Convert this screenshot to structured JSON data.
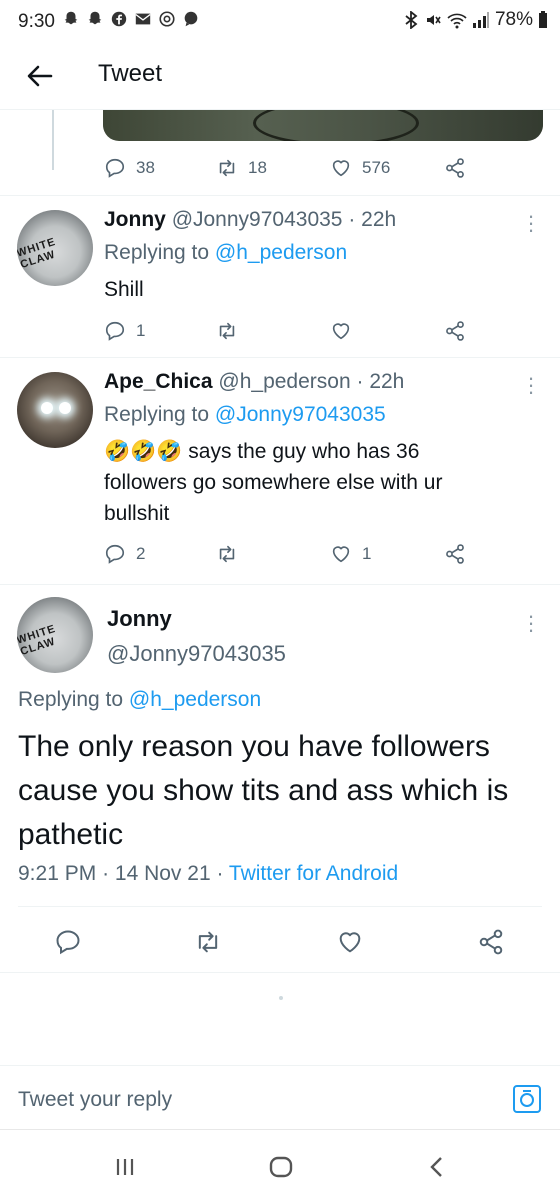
{
  "status_bar": {
    "time": "9:30",
    "battery": "78%",
    "left_icons": [
      "snapchat-icon",
      "snapchat-icon",
      "facebook-icon",
      "mail-icon",
      "at-icon",
      "message-icon"
    ],
    "right_icons": [
      "bluetooth-icon",
      "mute-icon",
      "wifi-icon",
      "signal-icon",
      "battery-icon"
    ]
  },
  "header": {
    "title": "Tweet",
    "back_icon": "arrow-left-icon"
  },
  "parent_tweet_stats": {
    "replies": "38",
    "retweets": "18",
    "likes": "576"
  },
  "replies": [
    {
      "name": "Jonny",
      "handle": "@Jonny97043035",
      "time": "22h",
      "replying_prefix": "Replying to",
      "replying_to": "@h_pederson",
      "text": "Shill",
      "avatar_text": "WHITE CLAW",
      "stats": {
        "replies": "1",
        "retweets": "",
        "likes": ""
      }
    },
    {
      "name": "Ape_Chica",
      "handle": "@h_pederson",
      "time": "22h",
      "replying_prefix": "Replying to",
      "replying_to": "@Jonny97043035",
      "text_line1": "🤣🤣🤣 says the guy who has 36",
      "text_line2": "followers go somewhere else with ur",
      "text_line3": "bullshit",
      "stats": {
        "replies": "2",
        "retweets": "",
        "likes": "1"
      }
    }
  ],
  "main_tweet": {
    "name": "Jonny",
    "handle": "@Jonny97043035",
    "avatar_text": "WHITE CLAW",
    "replying_prefix": "Replying to",
    "replying_to": "@h_pederson",
    "text": "The only reason you have followers cause you show tits and ass which is pathetic",
    "time": "9:21 PM",
    "date": "14 Nov 21",
    "source": "Twitter for Android"
  },
  "reply_bar": {
    "placeholder": "Tweet your reply"
  },
  "colors": {
    "link": "#1d9bf0",
    "secondary": "#536471",
    "text": "#0f1419"
  }
}
